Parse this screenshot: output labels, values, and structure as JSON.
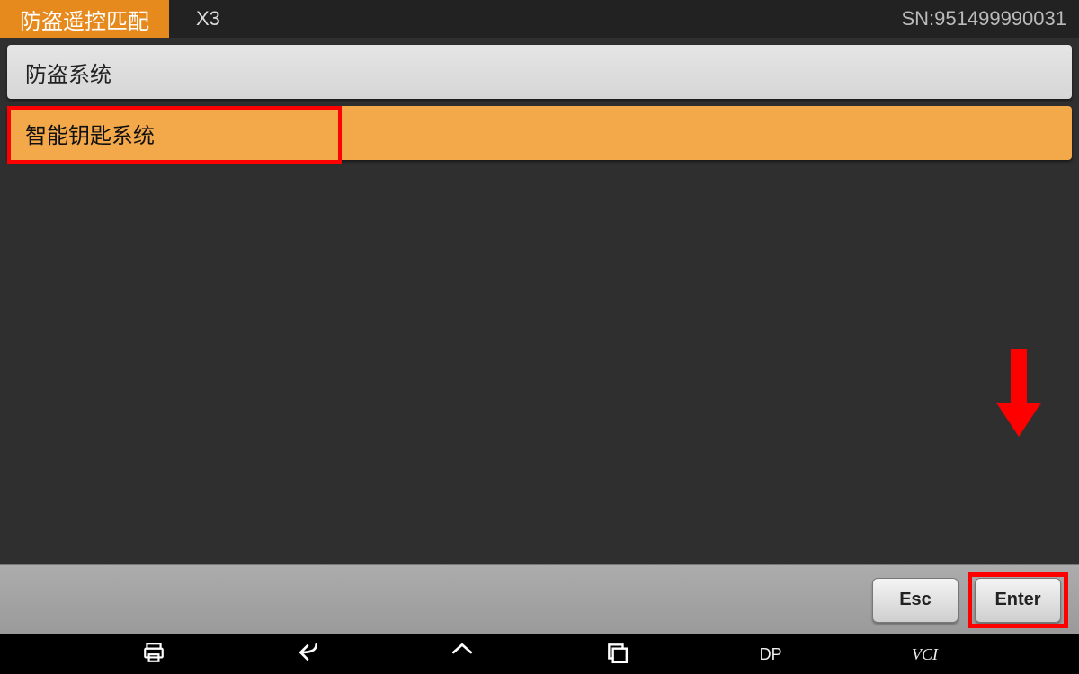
{
  "header": {
    "title": "防盗遥控匹配",
    "subtitle": "X3",
    "sn": "SN:951499990031"
  },
  "list": {
    "items": [
      {
        "label": "防盗系统",
        "selected": false
      },
      {
        "label": "智能钥匙系统",
        "selected": true
      }
    ]
  },
  "buttons": {
    "esc": "Esc",
    "enter": "Enter"
  },
  "nav": {
    "dp": "DP",
    "vci": "VCI"
  }
}
